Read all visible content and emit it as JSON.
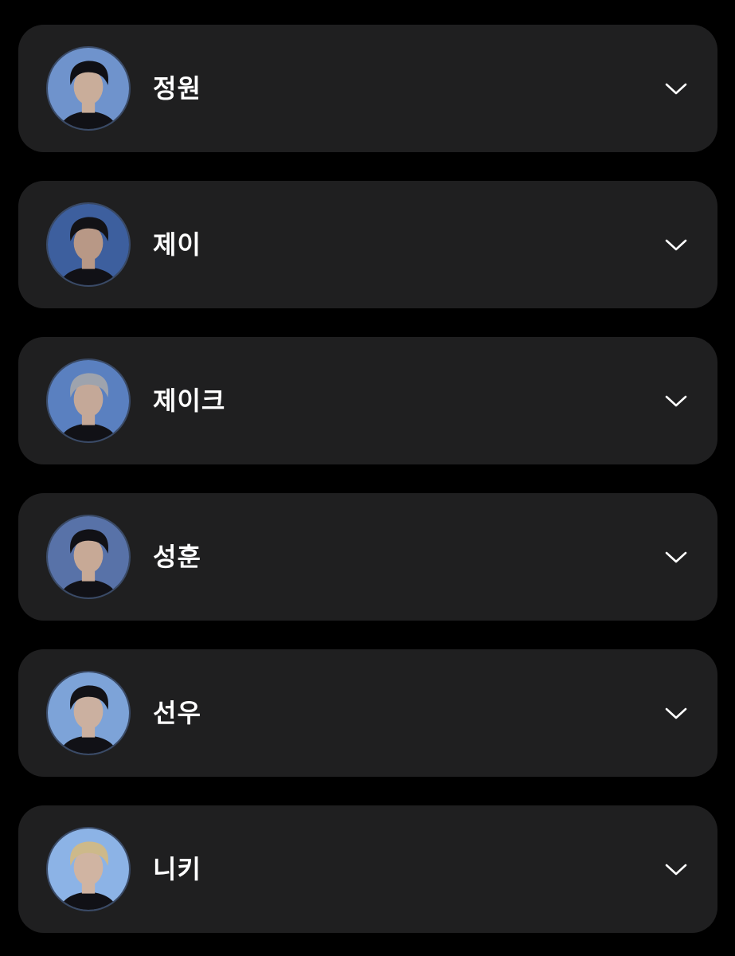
{
  "members": [
    {
      "name": "정원",
      "avatar_icon": "member-portrait-icon",
      "bg_color": "#6f93cc",
      "hair_color": "#0f0f14",
      "skin_color": "#c9ad9a"
    },
    {
      "name": "제이",
      "avatar_icon": "member-portrait-icon",
      "bg_color": "#3d5f9e",
      "hair_color": "#121216",
      "skin_color": "#b89886"
    },
    {
      "name": "제이크",
      "avatar_icon": "member-portrait-icon",
      "bg_color": "#5a80c0",
      "hair_color": "#9ea3ad",
      "skin_color": "#c4a898"
    },
    {
      "name": "성훈",
      "avatar_icon": "member-portrait-icon",
      "bg_color": "#5872a8",
      "hair_color": "#111116",
      "skin_color": "#c7a996"
    },
    {
      "name": "선우",
      "avatar_icon": "member-portrait-icon",
      "bg_color": "#7da3d8",
      "hair_color": "#121217",
      "skin_color": "#cbb0a0"
    },
    {
      "name": "니키",
      "avatar_icon": "member-portrait-icon",
      "bg_color": "#8cb3e6",
      "hair_color": "#cdb98a",
      "skin_color": "#d0b4a2"
    }
  ],
  "chevron_icon": "chevron-down-icon",
  "colors": {
    "background": "#000000",
    "card": "#1f1f20",
    "text": "#ffffff"
  }
}
